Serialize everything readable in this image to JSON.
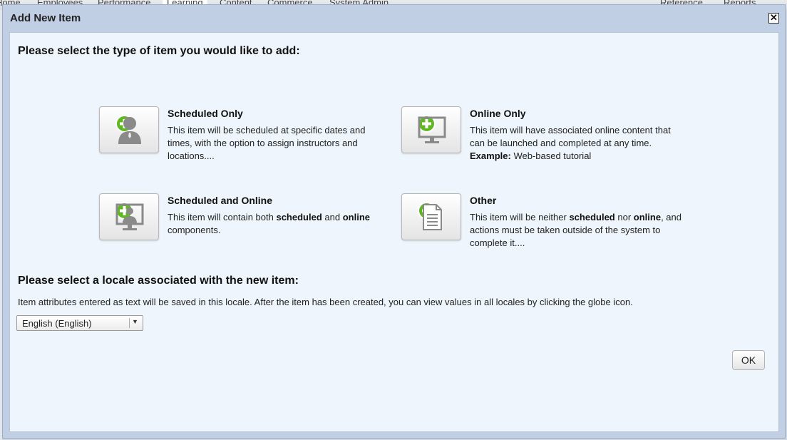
{
  "background_nav": {
    "items": [
      "Home",
      "Employees",
      "Performance",
      "Learning",
      "Content",
      "Commerce",
      "System Admin",
      "Reference",
      "Reports"
    ]
  },
  "dialog": {
    "title": "Add New Item",
    "close_icon": "close-icon"
  },
  "type_section": {
    "heading": "Please select the type of item you would like to add:",
    "options": [
      {
        "title": "Scheduled Only",
        "icon": "person-icon",
        "desc_plain": "This item will be scheduled at specific dates and times, with the option to assign instructors and locations...."
      },
      {
        "title": "Online Only",
        "icon": "monitor-icon",
        "desc_plain": "This item will have associated online content that can be launched and completed at any time.",
        "example_label": "Example:",
        "example_value": "Web-based tutorial"
      },
      {
        "title": "Scheduled and Online",
        "icon": "person-monitor-icon",
        "desc_prefix": "This item will contain both",
        "desc_bold1": "scheduled",
        "desc_mid": "and",
        "desc_bold2": "online",
        "desc_suffix": "components."
      },
      {
        "title": "Other",
        "icon": "document-icon",
        "desc_prefix": "This item will be neither",
        "desc_bold1": "scheduled",
        "desc_mid": "nor",
        "desc_bold2": "online",
        "desc_suffix": ", and actions must be taken outside of the system to complete it...."
      }
    ],
    "add_icon": "plus-circle-icon"
  },
  "locale_section": {
    "heading": "Please select a locale associated with the new item:",
    "note": "Item attributes entered as text will be saved in this locale. After the item has been created, you can view values in all locales by clicking the globe icon.",
    "selected": "English (English)"
  },
  "footer": {
    "ok_label": "OK"
  },
  "colors": {
    "dialog_frame": "#c0cfe4",
    "dialog_body": "#eef5fc",
    "plus_green": "#5fb81f",
    "icon_gray": "#8a8a8a"
  }
}
